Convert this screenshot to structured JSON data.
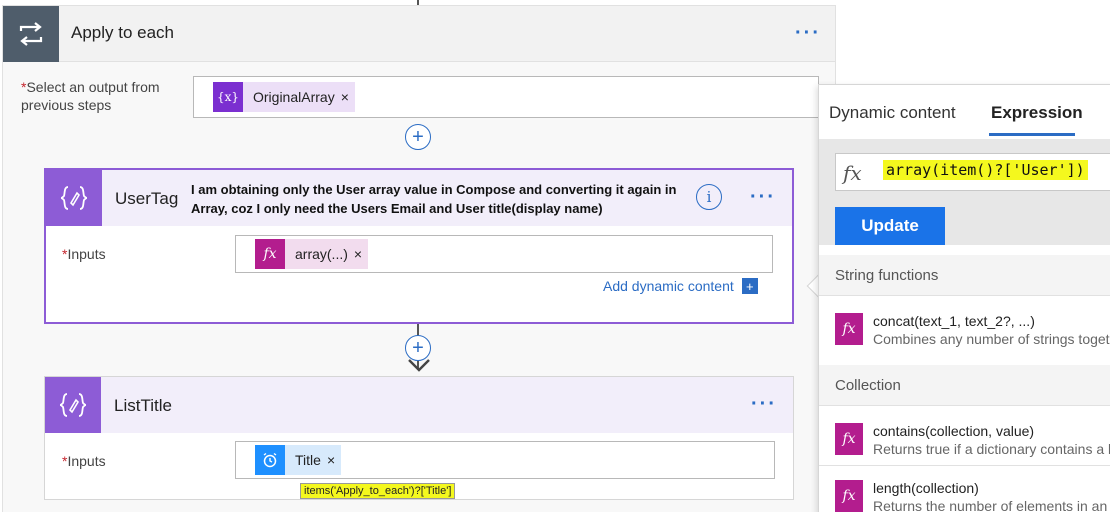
{
  "scope": {
    "title": "Apply to each",
    "select_required": "*",
    "select_label": "Select an output from previous steps",
    "token_label": "OriginalArray",
    "token_icon": "{x}",
    "token_remove": "×",
    "menu_dots": "···"
  },
  "usertag": {
    "title": "UserTag",
    "comment": "I am obtaining only the User array value in Compose and converting it again in Array, coz I only need the Users Email and User title(display name)",
    "info": "i",
    "inputs_required": "*",
    "inputs_label": "Inputs",
    "token_label": "array(...)",
    "token_icon": "fx",
    "token_remove": "×",
    "add_dynamic": "Add dynamic content",
    "add_dynamic_icon": "+",
    "menu_dots": "···"
  },
  "listtitle": {
    "title": "ListTitle",
    "inputs_required": "*",
    "inputs_label": "Inputs",
    "token_label": "Title",
    "token_remove": "×",
    "menu_dots": "···"
  },
  "tooltip": "items('Apply_to_each')?['Title']",
  "panel": {
    "tab_dynamic": "Dynamic content",
    "tab_expression": "Expression",
    "expr_fx": "fx",
    "expression": "array(item()?['User'])",
    "update_label": "Update",
    "section_string": "String functions",
    "section_collection": "Collection",
    "functions": [
      {
        "name": "concat(text_1, text_2?, ...)",
        "desc": "Combines any number of strings together",
        "icon": "fx"
      },
      {
        "name": "contains(collection, value)",
        "desc": "Returns true if a dictionary contains a key",
        "icon": "fx"
      },
      {
        "name": "length(collection)",
        "desc": "Returns the number of elements in an array",
        "icon": "fx"
      }
    ]
  },
  "colors": {
    "scope_icon": "#4f5d6b",
    "compose_icon": "#8d5cd6",
    "compose_header": "#f2eefa",
    "selected_border": "#8d5cd6",
    "variable_token": "#7b2fd0",
    "expression_token": "#b31d8e",
    "trigger_token": "#1e90ff",
    "link": "#2b6cc4",
    "update_button": "#1a73e8",
    "highlight": "#f4f81e"
  },
  "icons": {
    "scope": "loop-icon",
    "compose": "compose-icon",
    "title_token": "alarm-icon"
  }
}
